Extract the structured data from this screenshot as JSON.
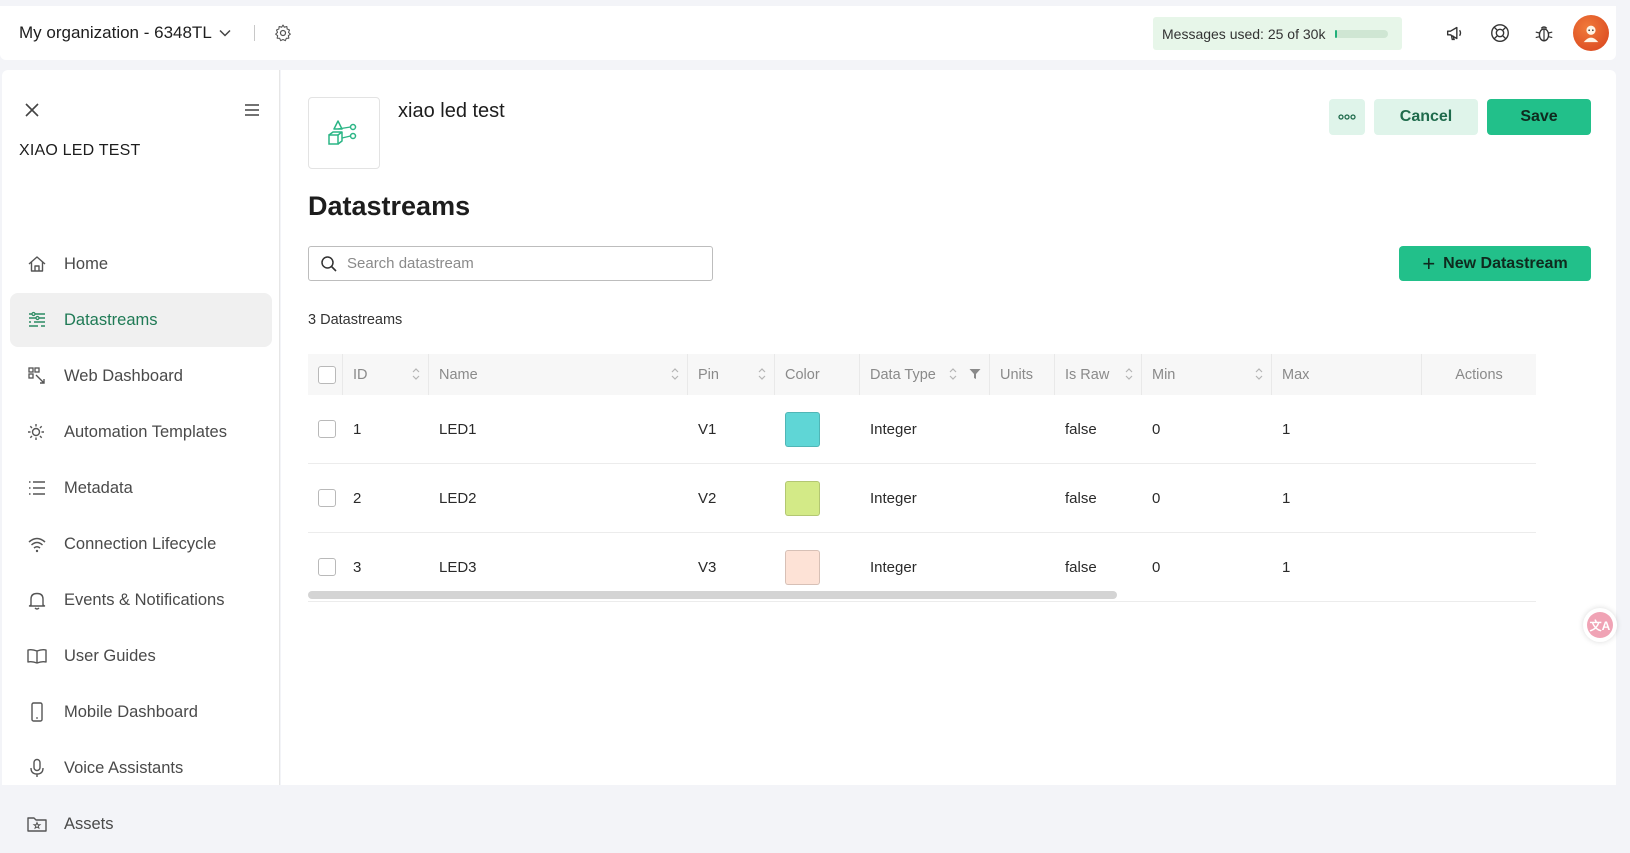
{
  "topbar": {
    "org_name": "My organization - 6348TL",
    "messages_label": "Messages used:",
    "messages_value": "25 of 30k",
    "messages_fraction": 0.001
  },
  "sidebar": {
    "title": "XIAO LED TEST",
    "items": [
      {
        "label": "Home",
        "icon": "home-icon",
        "active": false
      },
      {
        "label": "Datastreams",
        "icon": "datastreams-icon",
        "active": true
      },
      {
        "label": "Web Dashboard",
        "icon": "web-dashboard-icon",
        "active": false
      },
      {
        "label": "Automation Templates",
        "icon": "automation-icon",
        "active": false
      },
      {
        "label": "Metadata",
        "icon": "metadata-icon",
        "active": false
      },
      {
        "label": "Connection Lifecycle",
        "icon": "wifi-icon",
        "active": false
      },
      {
        "label": "Events & Notifications",
        "icon": "bell-icon",
        "active": false
      },
      {
        "label": "User Guides",
        "icon": "book-icon",
        "active": false
      },
      {
        "label": "Mobile Dashboard",
        "icon": "phone-icon",
        "active": false
      },
      {
        "label": "Voice Assistants",
        "icon": "microphone-icon",
        "active": false
      },
      {
        "label": "Assets",
        "icon": "folder-icon",
        "active": false
      }
    ]
  },
  "main": {
    "template_name": "xiao led test",
    "cancel_label": "Cancel",
    "save_label": "Save",
    "page_title": "Datastreams",
    "search_placeholder": "Search datastream",
    "new_button_label": "New Datastream",
    "count_label": "3 Datastreams"
  },
  "table": {
    "columns": [
      "ID",
      "Name",
      "Pin",
      "Color",
      "Data Type",
      "Units",
      "Is Raw",
      "Min",
      "Max",
      "Actions"
    ],
    "rows": [
      {
        "id": "1",
        "name": "LED1",
        "pin": "V1",
        "color": "#5fd6d6",
        "type": "Integer",
        "units": "",
        "raw": "false",
        "min": "0",
        "max": "1"
      },
      {
        "id": "2",
        "name": "LED2",
        "pin": "V2",
        "color": "#d3ea87",
        "type": "Integer",
        "units": "",
        "raw": "false",
        "min": "0",
        "max": "1"
      },
      {
        "id": "3",
        "name": "LED3",
        "pin": "V3",
        "color": "#fde2d6",
        "type": "Integer",
        "units": "",
        "raw": "false",
        "min": "0",
        "max": "1"
      }
    ]
  },
  "colors": {
    "accent": "#22c08a",
    "accent_light": "#dff4ea",
    "active_text": "#1f7a55"
  }
}
